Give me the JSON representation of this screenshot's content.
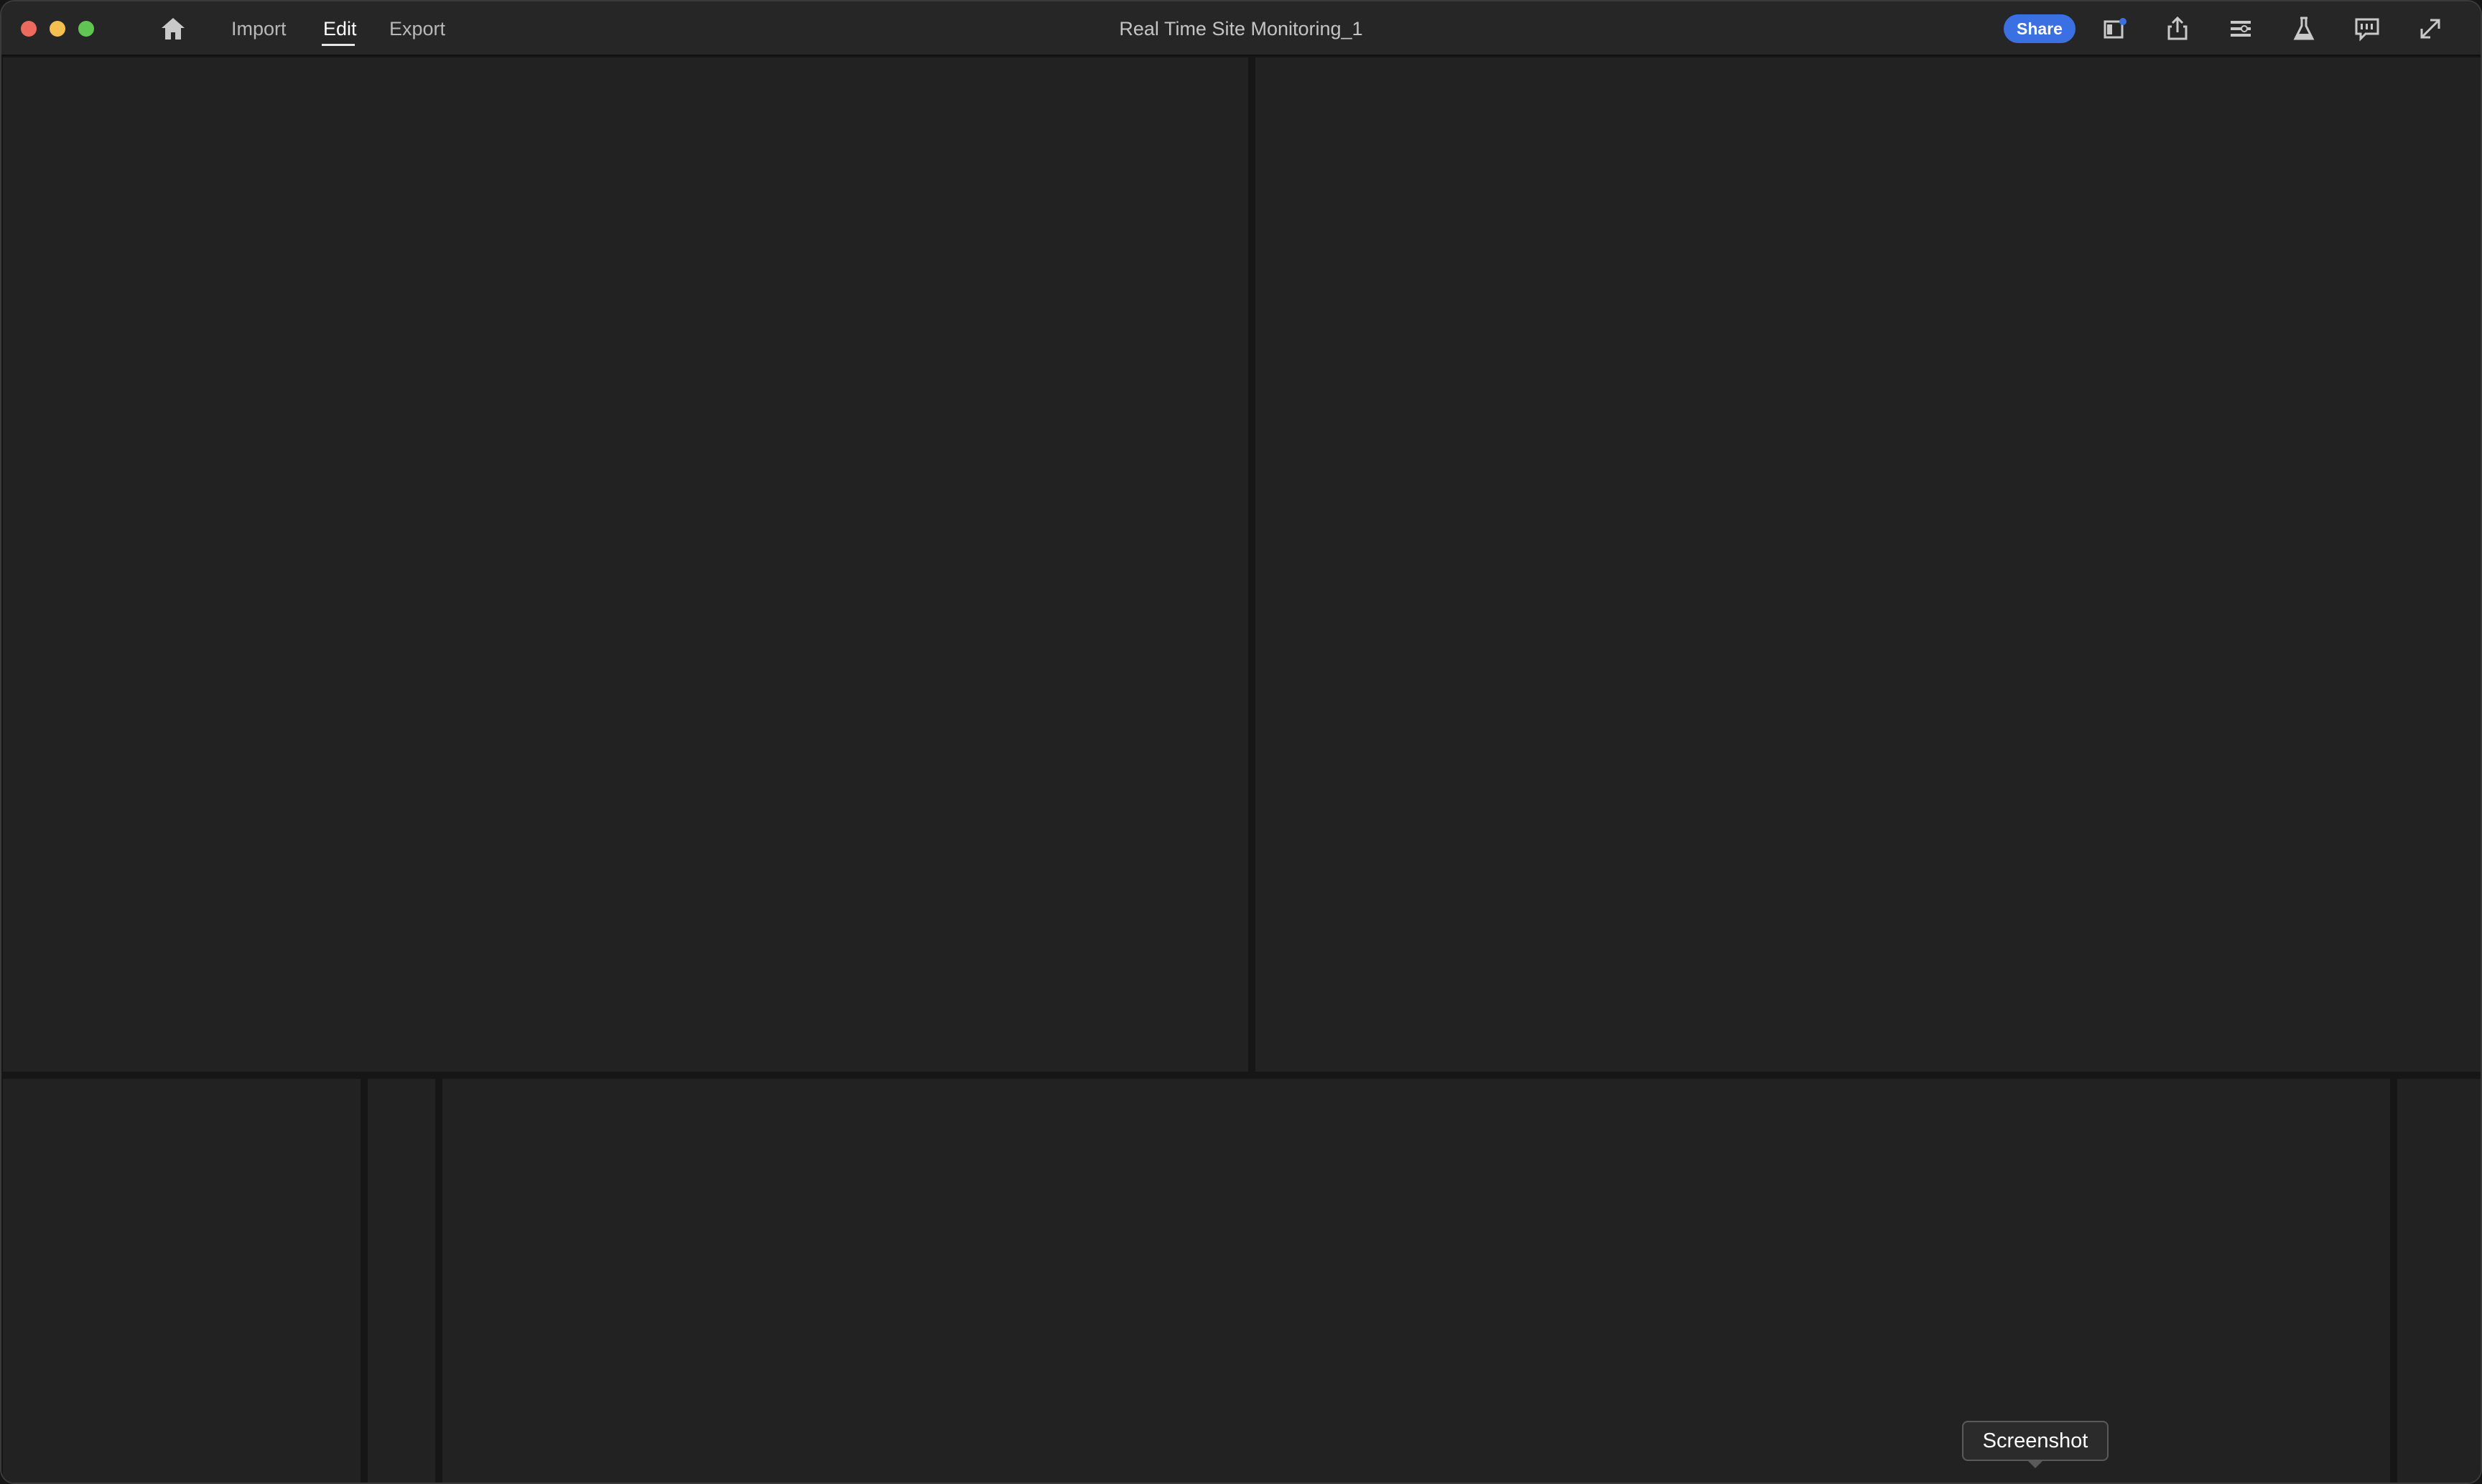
{
  "window": {
    "traffic_lights": [
      "close",
      "minimize",
      "zoom"
    ]
  },
  "nav": {
    "home_icon": "home-icon",
    "items": [
      {
        "label": "Import",
        "active": false
      },
      {
        "label": "Edit",
        "active": true
      },
      {
        "label": "Export",
        "active": false
      }
    ]
  },
  "document": {
    "title": "Real Time Site Monitoring_1"
  },
  "toolbar": {
    "share_label": "Share",
    "icons": [
      "panel-notification-icon",
      "export-share-icon",
      "list-settings-icon",
      "lab-flask-icon",
      "feedback-chat-icon",
      "fullscreen-icon"
    ]
  },
  "tooltip": {
    "text": "Screenshot"
  },
  "colors": {
    "accent": "#3b70e3",
    "panel_bg": "#222222",
    "divider": "#161616",
    "titlebar_bg": "#262626"
  }
}
